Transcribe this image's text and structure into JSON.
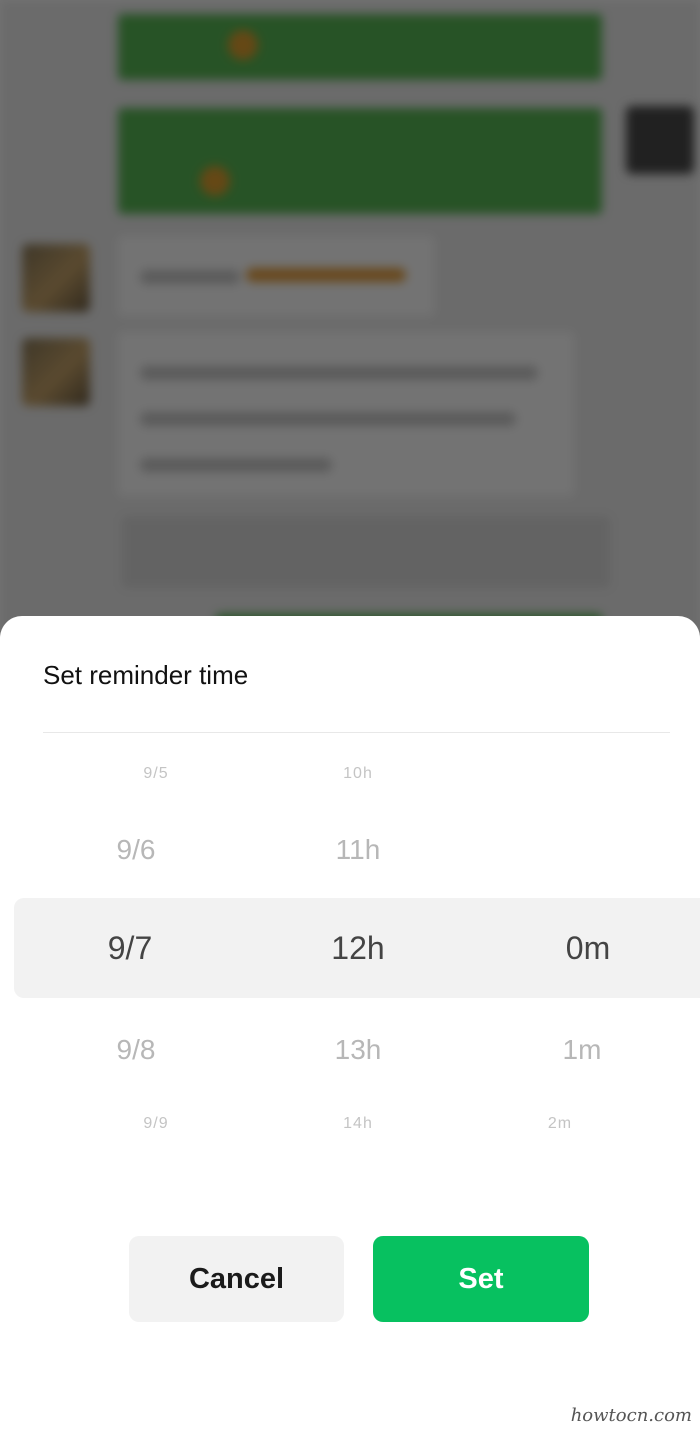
{
  "sheet": {
    "title": "Set reminder time"
  },
  "picker": {
    "date": {
      "far_above": "9/5",
      "above": "9/6",
      "selected": "9/7",
      "below": "9/8",
      "far_below": "9/9"
    },
    "hour": {
      "far_above": "10h",
      "above": "11h",
      "selected": "12h",
      "below": "13h",
      "far_below": "14h"
    },
    "minute": {
      "selected": "0m",
      "below": "1m",
      "far_below": "2m"
    }
  },
  "buttons": {
    "cancel_label": "Cancel",
    "set_label": "Set"
  },
  "watermark": "howtocn.com",
  "colors": {
    "accent": "#07c160",
    "selection_band": "#f2f2f2",
    "overlay": "#000000"
  }
}
